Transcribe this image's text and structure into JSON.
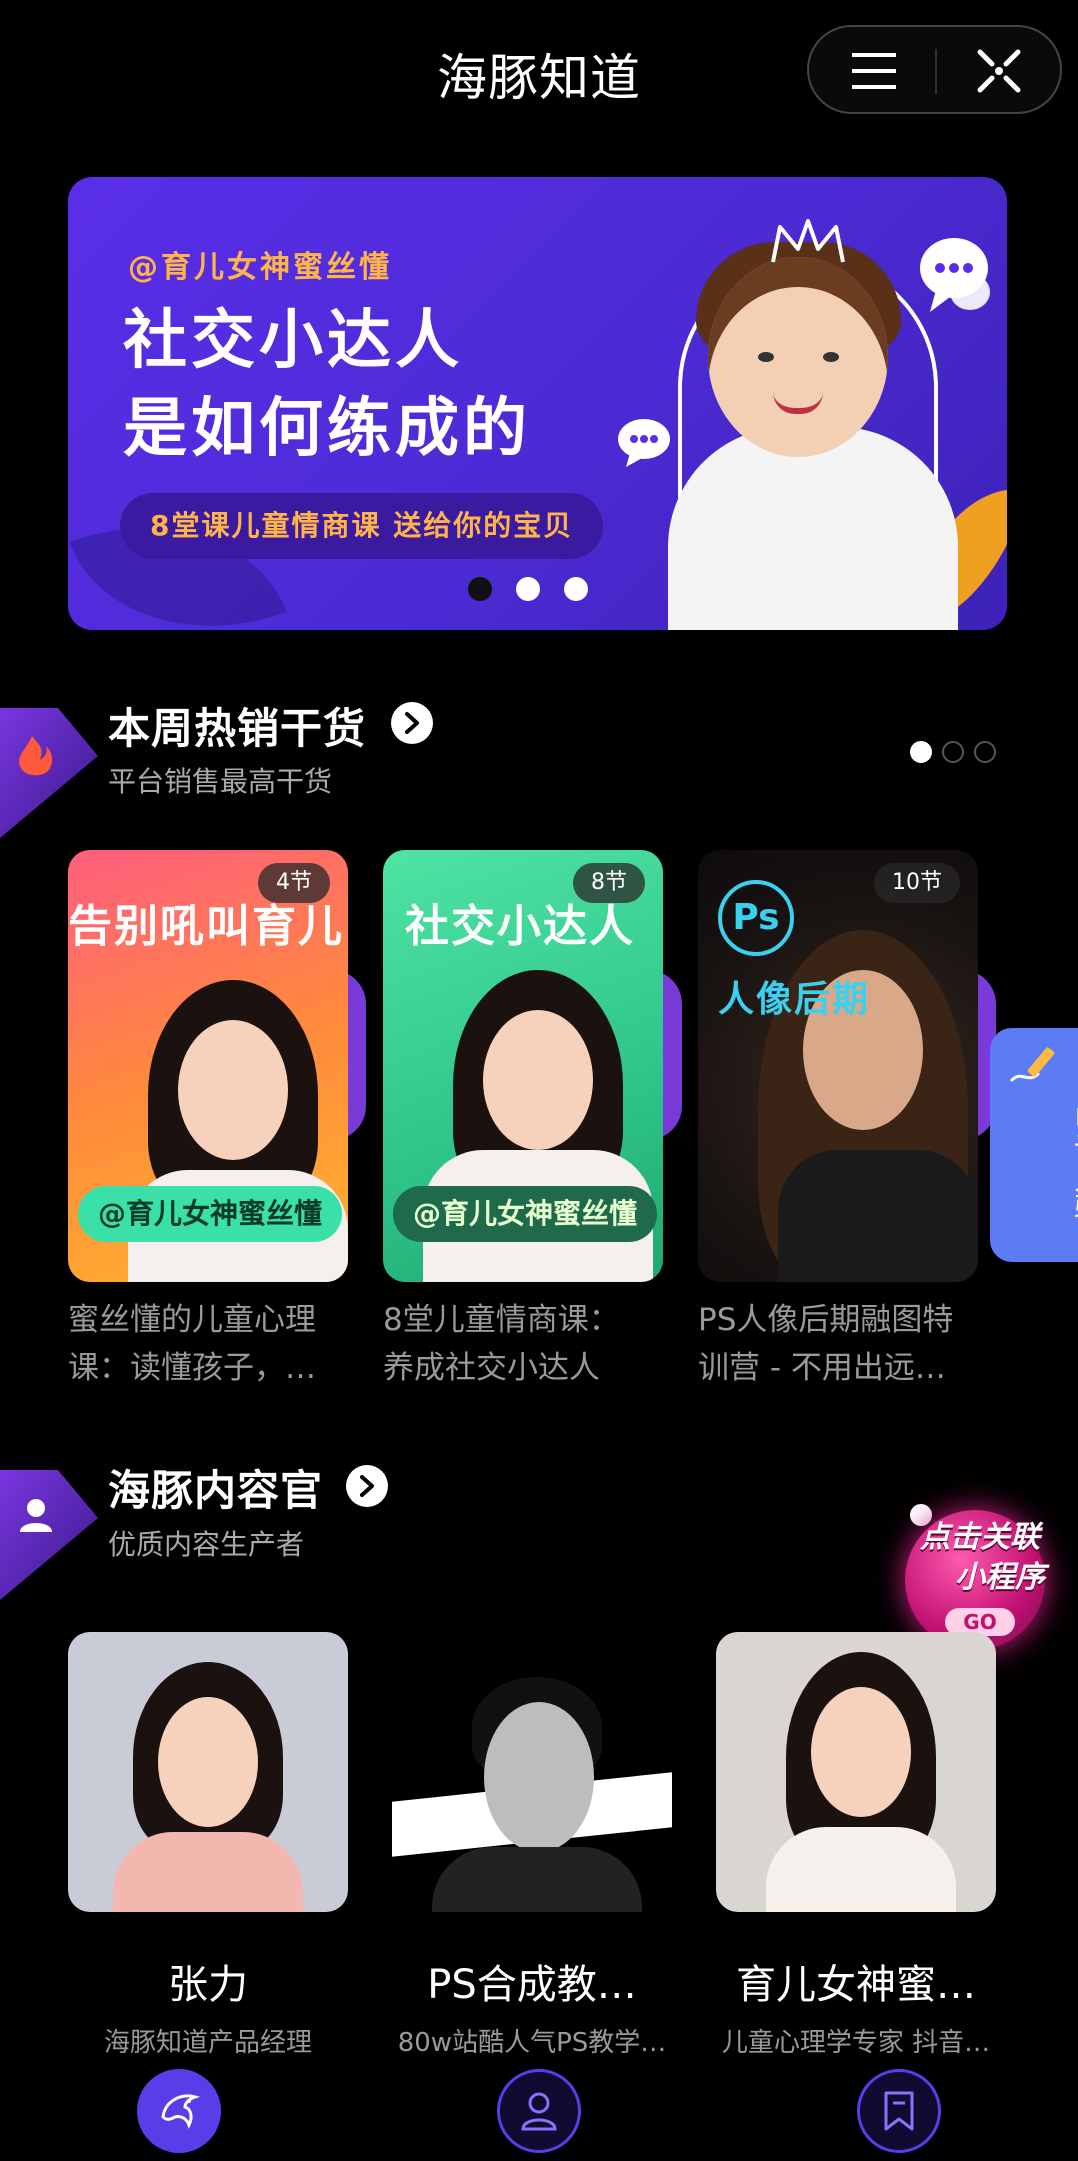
{
  "app": {
    "title": "海豚知道"
  },
  "banner": {
    "author": "@育儿女神蜜丝懂",
    "title_line1": "社交小达人",
    "title_line2": "是如何练成的",
    "pill": "8堂课儿童情商课 送给你的宝贝",
    "dots_count": 3,
    "active_dot": 0
  },
  "hot_section": {
    "title": "本周热销干货",
    "subtitle": "平台销售最高干货",
    "icon": "flame-icon",
    "badge_color": "#6a2ccf"
  },
  "courses": [
    {
      "tag": "4节",
      "headline": "告别吼叫育儿",
      "author": "@育儿女神蜜丝懂",
      "title_line1": "蜜丝懂的儿童心理",
      "title_line2": "课：读懂孩子，…"
    },
    {
      "tag": "8节",
      "headline": "社交小达人",
      "author": "@育儿女神蜜丝懂",
      "title_line1": "8堂儿童情商课：",
      "title_line2": "养成社交小达人"
    },
    {
      "tag": "10节",
      "ps_logo": "Ps",
      "headline": "人像后期",
      "title_line1": "PS人像后期融图特",
      "title_line2": "训营 - 不用出远…"
    }
  ],
  "apply_tab": {
    "label": "申请入驻"
  },
  "creator_section": {
    "title": "海豚内容官",
    "subtitle": "优质内容生产者",
    "icon": "user-icon"
  },
  "promo": {
    "line1": "点击关联",
    "line2": "小程序",
    "go": "GO"
  },
  "creators": [
    {
      "name": "张力",
      "desc": "海豚知道产品经理"
    },
    {
      "name": "PS合成教…",
      "desc": "80w站酷人气PS教学…"
    },
    {
      "name": "育儿女神蜜…",
      "desc": "儿童心理学专家 抖音…"
    }
  ],
  "tabbar": [
    "dolphin-icon",
    "profile-icon",
    "bookmark-icon"
  ],
  "colors": {
    "accent": "#5b3de8",
    "banner_orange": "#ffb44a",
    "tab_ring": "#5b3de8"
  }
}
